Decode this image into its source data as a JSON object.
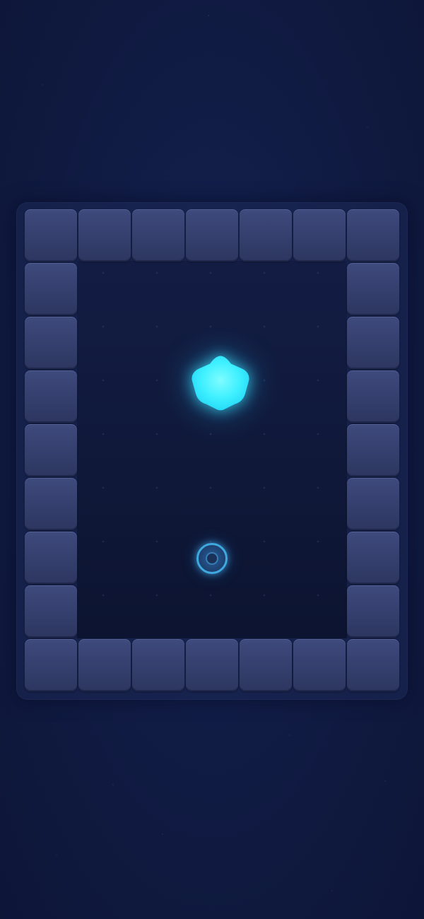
{
  "game": {
    "grid": {
      "columns": 7,
      "rows": 9
    },
    "walls": "border",
    "crystal": {
      "shape": "pentagon",
      "color": "#3ff0ff",
      "glow_color": "#28c8ff",
      "icon": "crystal-icon"
    },
    "player": {
      "shape": "ring",
      "color": "#3fa9e0",
      "icon": "player-marker-icon"
    },
    "colors": {
      "background": "#111c45",
      "arena": "#0f1838",
      "wall_tile": "#3a4575"
    }
  }
}
